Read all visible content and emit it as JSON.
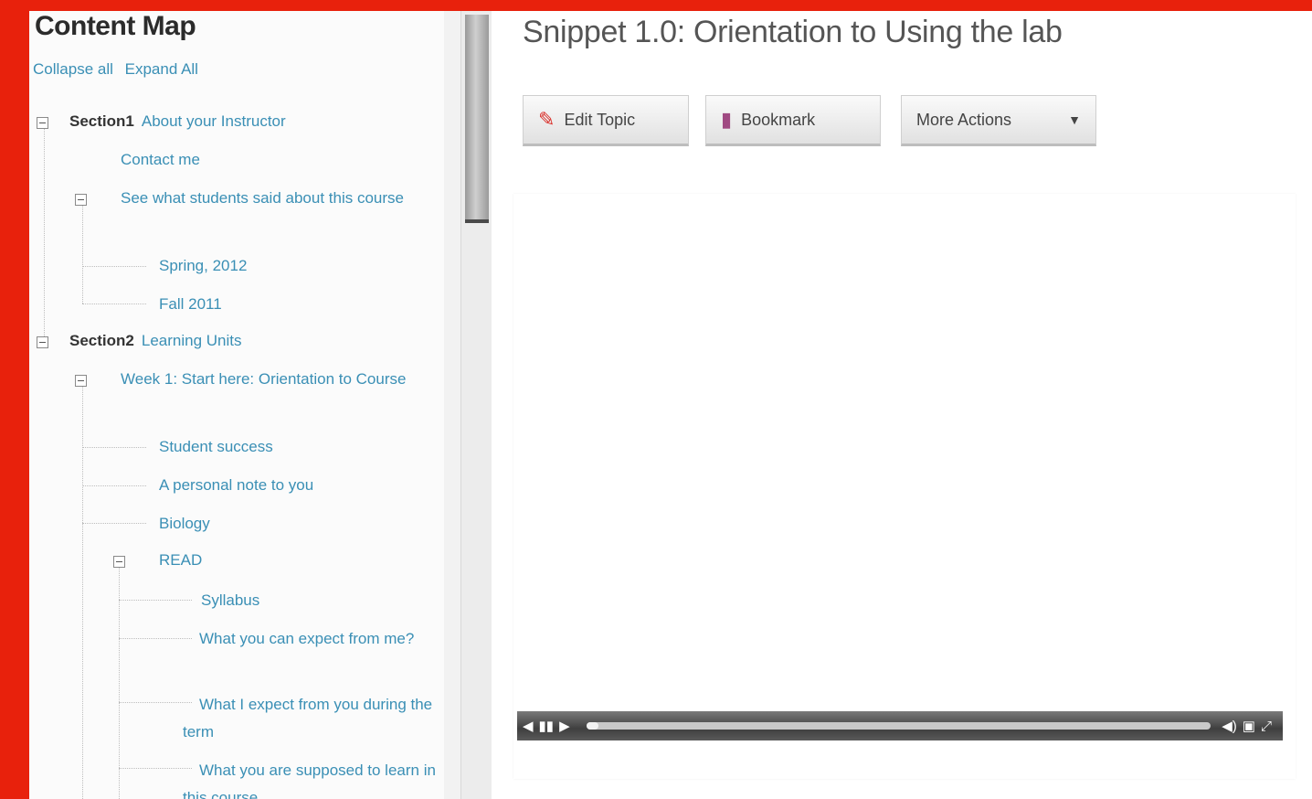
{
  "content_map": {
    "title": "Content Map",
    "collapse_all": "Collapse all",
    "expand_all": "Expand All",
    "sections": {
      "s1_label": "Section1",
      "s1_title": "About your Instructor",
      "s1_contact": "Contact me",
      "s1_see_what": "See what students said about this course",
      "s1_spring": "Spring, 2012",
      "s1_fall": "Fall 2011",
      "s2_label": "Section2",
      "s2_title": "Learning Units",
      "s2_week1": "Week 1: Start here: Orientation to Course",
      "s2_student_success": "Student success",
      "s2_personal_note": "A personal note to you",
      "s2_biology": "Biology",
      "s2_read": "READ",
      "s2_syllabus": "Syllabus",
      "s2_what_expect_from_me": "What you can expect from me?",
      "s2_what_i_expect": "What I expect from you during the term",
      "s2_what_supposed": "What you are supposed to learn in this course"
    }
  },
  "main": {
    "snippet_title": "Snippet 1.0: Orientation to Using the lab",
    "edit_topic_label": "Edit Topic",
    "bookmark_label": "Bookmark",
    "more_actions_label": "More Actions",
    "icons": {
      "edit": "pencil-icon",
      "bookmark": "bookmark-icon",
      "dropdown": "chevron-down-icon"
    }
  },
  "player": {
    "progress": 0.02
  },
  "colors": {
    "background_frame": "#e8210c",
    "link": "#3a8fb5"
  }
}
